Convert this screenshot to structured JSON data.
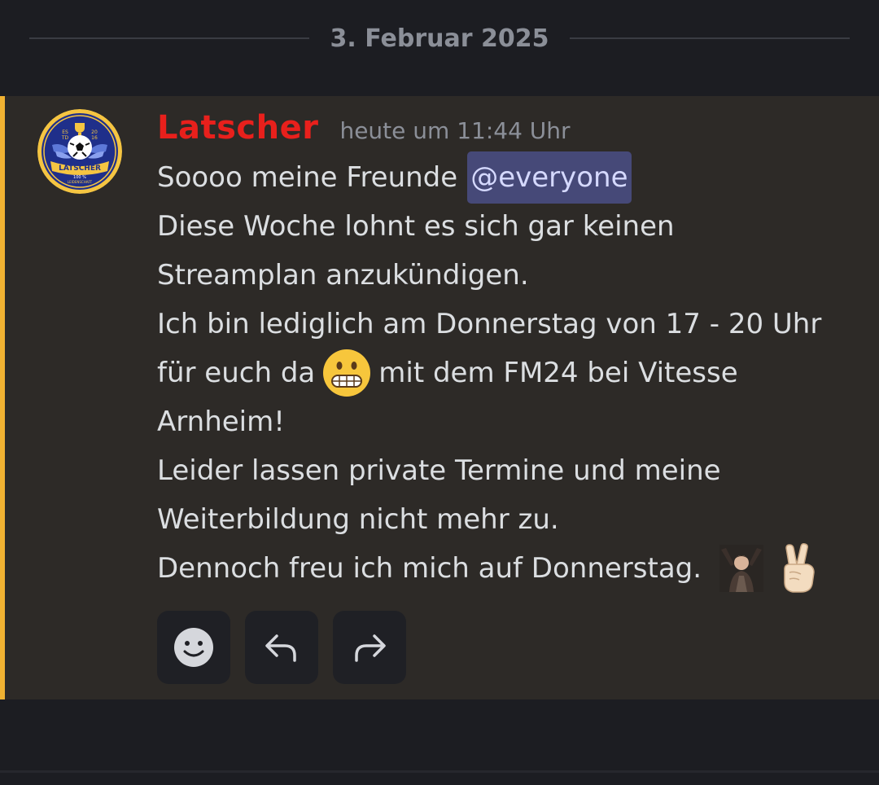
{
  "date_divider": {
    "label": "3. Februar 2025"
  },
  "message": {
    "author": "Latscher",
    "author_color": "#e8201c",
    "timestamp": "heute um 11:44 Uhr",
    "highlight_color": "#f0b232",
    "lines": {
      "line1_text": "Soooo meine Freunde",
      "mention": "@everyone",
      "line2": "Diese Woche lohnt es sich gar keinen",
      "line3": "Streamplan anzukündigen.",
      "line4": "Ich bin lediglich am Donnerstag von 17 - 20 Uhr",
      "line5_before": "für euch da",
      "line5_after": "mit dem FM24 bei Vitesse",
      "line6": "Arnheim!",
      "line7": "Leider lassen private Termine und meine",
      "line8": "Weiterbildung nicht mehr zu.",
      "line9": "Dennoch freu ich mich auf Donnerstag."
    },
    "avatar_logo_text": {
      "name": "LATSCHER",
      "est_left": "ES",
      "est_right": "20",
      "year_left": "TD",
      "year_right": "16",
      "sub": "100 %",
      "sub2": "LEIDENSCHAFT"
    },
    "icons": {
      "inline_emoji": "grimacing-face-icon",
      "custom_emote": "cheering-person-emote-icon",
      "victory_emoji": "victory-hand-icon"
    }
  },
  "actions": {
    "react": "add-reaction-icon",
    "reply": "reply-icon",
    "forward": "forward-icon"
  }
}
